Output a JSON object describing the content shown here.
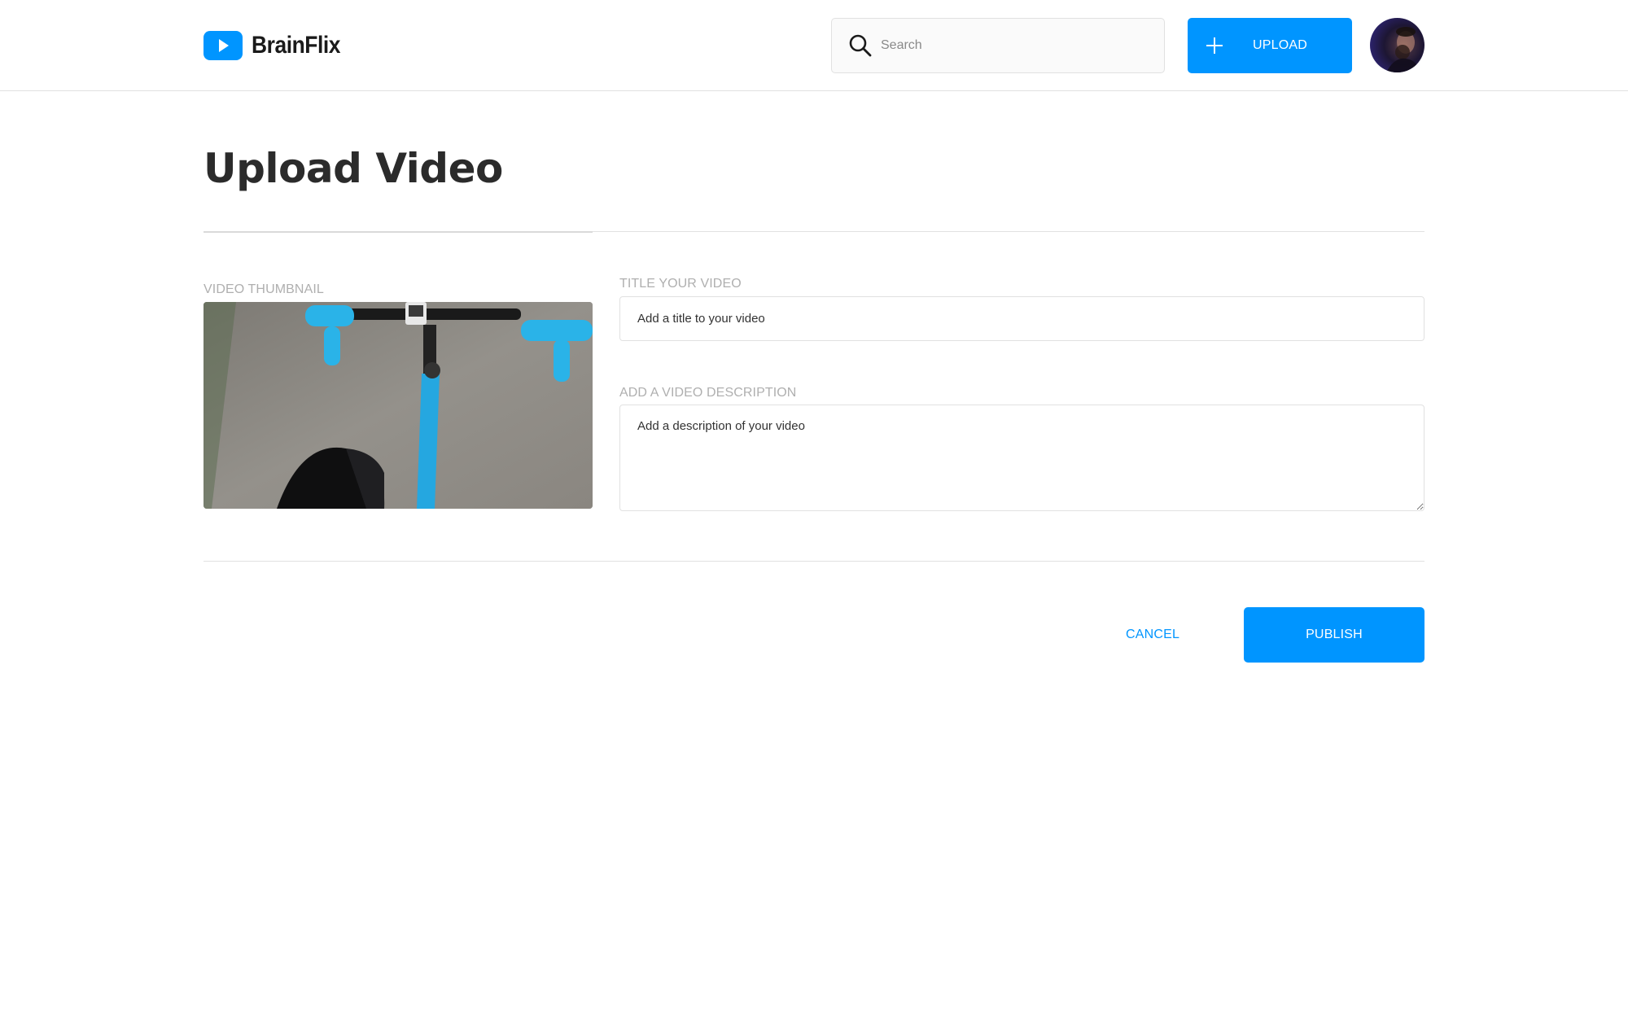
{
  "header": {
    "logo_text": "BrainFlix",
    "search": {
      "placeholder": "Search",
      "value": ""
    },
    "upload_label": "UPLOAD",
    "icons": {
      "logo": "play-icon",
      "search": "search-icon",
      "upload": "plus-icon",
      "avatar": "avatar"
    }
  },
  "main": {
    "title": "Upload Video",
    "thumbnail_label": "VIDEO THUMBNAIL",
    "title_field": {
      "label": "TITLE YOUR VIDEO",
      "placeholder": "Add a title to your video",
      "value": ""
    },
    "description_field": {
      "label": "ADD A VIDEO DESCRIPTION",
      "placeholder": "Add a description of your video",
      "value": ""
    },
    "actions": {
      "cancel_label": "CANCEL",
      "publish_label": "PUBLISH"
    }
  },
  "colors": {
    "accent": "#0095FF",
    "text": "#323232",
    "label": "#AFAFAF",
    "border": "#E1E1E1"
  }
}
